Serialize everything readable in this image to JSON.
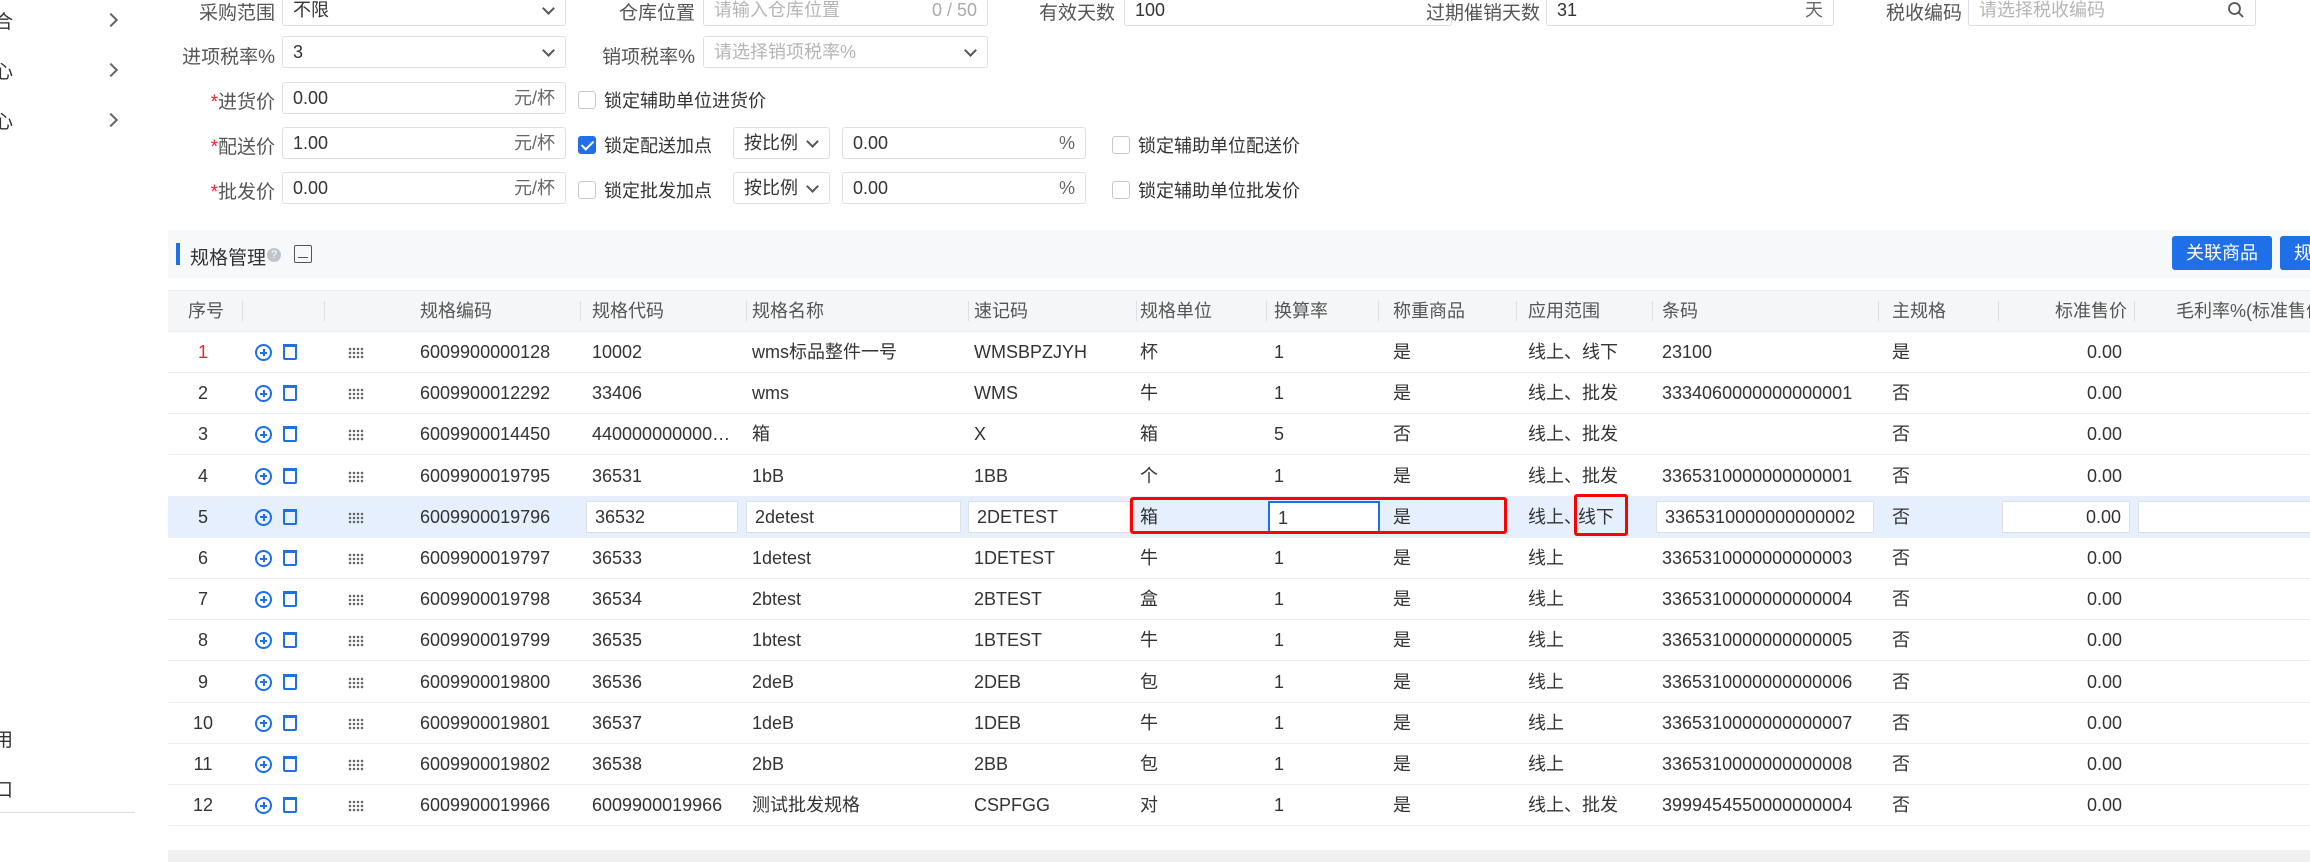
{
  "sidebar": {
    "items": [
      {
        "label": "合",
        "chevron": true
      },
      {
        "label": "心",
        "chevron": true
      },
      {
        "label": "心",
        "chevron": true
      },
      {
        "label": "用",
        "chevron": false
      },
      {
        "label": "口",
        "chevron": false
      }
    ]
  },
  "form": {
    "purchase_scope": {
      "label": "采购范围",
      "value": "不限"
    },
    "warehouse_location": {
      "label": "仓库位置",
      "placeholder": "请输入仓库位置",
      "counter": "0 / 50"
    },
    "valid_days": {
      "label": "有效天数",
      "value": "100"
    },
    "expiry_reminder": {
      "label": "过期催销天数",
      "value": "31",
      "suffix": "天"
    },
    "tax_code": {
      "label": "税收编码",
      "placeholder": "请选择税收编码"
    },
    "input_tax": {
      "label": "进项税率%",
      "value": "3"
    },
    "output_tax": {
      "label": "销项税率%",
      "placeholder": "请选择销项税率%"
    },
    "purchase_price": {
      "required": "*",
      "label": "进货价",
      "value": "0.00",
      "suffix": "元/杯",
      "lock_aux_label": "锁定辅助单位进货价"
    },
    "delivery_price": {
      "required": "*",
      "label": "配送价",
      "value": "1.00",
      "suffix": "元/杯",
      "lock_markup_label": "锁定配送加点",
      "lock_markup_checked": true,
      "mode": "按比例",
      "markup": "0.00",
      "markup_suffix": "%",
      "lock_aux_label": "锁定辅助单位配送价"
    },
    "wholesale_price": {
      "required": "*",
      "label": "批发价",
      "value": "0.00",
      "suffix": "元/杯",
      "lock_markup_label": "锁定批发加点",
      "lock_markup_checked": false,
      "mode": "按比例",
      "markup": "0.00",
      "markup_suffix": "%",
      "lock_aux_label": "锁定辅助单位批发价"
    }
  },
  "spec_section": {
    "title": "规格管理",
    "help": "?",
    "link_button": "关联商品",
    "next_button": "规"
  },
  "table": {
    "headers": [
      "序号",
      "规格编码",
      "规格代码",
      "规格名称",
      "速记码",
      "规格单位",
      "换算率",
      "称重商品",
      "应用范围",
      "条码",
      "主规格",
      "标准售价",
      "毛利率%(标准售价"
    ],
    "rows": [
      {
        "idx": "1",
        "code": "6009900000128",
        "spec_code": "10002",
        "name": "wms标品整件一号",
        "short": "WMSBPZJYH",
        "unit": "杯",
        "rate": "1",
        "weigh": "是",
        "scope": "线上、线下",
        "barcode": "23100",
        "main": "是",
        "price": "0.00"
      },
      {
        "idx": "2",
        "code": "6009900012292",
        "spec_code": "33406",
        "name": "wms",
        "short": "WMS",
        "unit": "牛",
        "rate": "1",
        "weigh": "是",
        "scope": "线上、批发",
        "barcode": "3334060000000000001",
        "main": "否",
        "price": "0.00"
      },
      {
        "idx": "3",
        "code": "6009900014450",
        "spec_code": "440000000000…",
        "name": "箱",
        "short": "X",
        "unit": "箱",
        "rate": "5",
        "weigh": "否",
        "scope": "线上、批发",
        "barcode": "",
        "main": "否",
        "price": "0.00"
      },
      {
        "idx": "4",
        "code": "6009900019795",
        "spec_code": "36531",
        "name": "1bB",
        "short": "1BB",
        "unit": "个",
        "rate": "1",
        "weigh": "是",
        "scope": "线上、批发",
        "barcode": "3365310000000000001",
        "main": "否",
        "price": "0.00"
      },
      {
        "idx": "5",
        "code": "6009900019796",
        "spec_code": "36532",
        "name": "2detest",
        "short": "2DETEST",
        "unit": "箱",
        "rate": "1",
        "weigh": "是",
        "scope_a": "线上、",
        "scope_b": "线下",
        "barcode": "3365310000000000002",
        "main": "否",
        "price": "0.00"
      },
      {
        "idx": "6",
        "code": "6009900019797",
        "spec_code": "36533",
        "name": "1detest",
        "short": "1DETEST",
        "unit": "牛",
        "rate": "1",
        "weigh": "是",
        "scope": "线上",
        "barcode": "3365310000000000003",
        "main": "否",
        "price": "0.00"
      },
      {
        "idx": "7",
        "code": "6009900019798",
        "spec_code": "36534",
        "name": "2btest",
        "short": "2BTEST",
        "unit": "盒",
        "rate": "1",
        "weigh": "是",
        "scope": "线上",
        "barcode": "3365310000000000004",
        "main": "否",
        "price": "0.00"
      },
      {
        "idx": "8",
        "code": "6009900019799",
        "spec_code": "36535",
        "name": "1btest",
        "short": "1BTEST",
        "unit": "牛",
        "rate": "1",
        "weigh": "是",
        "scope": "线上",
        "barcode": "3365310000000000005",
        "main": "否",
        "price": "0.00"
      },
      {
        "idx": "9",
        "code": "6009900019800",
        "spec_code": "36536",
        "name": "2deB",
        "short": "2DEB",
        "unit": "包",
        "rate": "1",
        "weigh": "是",
        "scope": "线上",
        "barcode": "3365310000000000006",
        "main": "否",
        "price": "0.00"
      },
      {
        "idx": "10",
        "code": "6009900019801",
        "spec_code": "36537",
        "name": "1deB",
        "short": "1DEB",
        "unit": "牛",
        "rate": "1",
        "weigh": "是",
        "scope": "线上",
        "barcode": "3365310000000000007",
        "main": "否",
        "price": "0.00"
      },
      {
        "idx": "11",
        "code": "6009900019802",
        "spec_code": "36538",
        "name": "2bB",
        "short": "2BB",
        "unit": "包",
        "rate": "1",
        "weigh": "是",
        "scope": "线上",
        "barcode": "3365310000000000008",
        "main": "否",
        "price": "0.00"
      },
      {
        "idx": "12",
        "code": "6009900019966",
        "spec_code": "6009900019966",
        "name": "测试批发规格",
        "short": "CSPFGG",
        "unit": "对",
        "rate": "1",
        "weigh": "是",
        "scope": "线上、批发",
        "barcode": "3999454550000000004",
        "main": "否",
        "price": "0.00"
      }
    ]
  },
  "colors": {
    "primary": "#1e6fe8",
    "highlight_box": "#ff0000",
    "selected_row": "#e6effd"
  }
}
